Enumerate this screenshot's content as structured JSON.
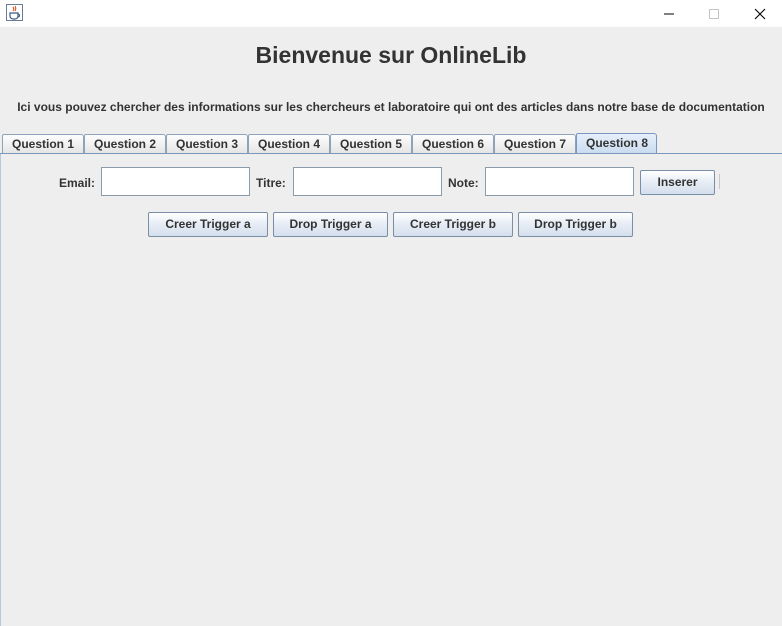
{
  "window": {
    "icons": {
      "app": "java-coffee-cup-icon",
      "minimize": "minimize-icon",
      "maximize": "maximize-icon",
      "close": "close-icon"
    }
  },
  "header": {
    "title": "Bienvenue sur OnlineLib",
    "subtitle": "Ici vous pouvez chercher des informations sur les chercheurs et laboratoire qui ont des articles dans notre base de documentation"
  },
  "tabs": [
    {
      "label": "Question 1"
    },
    {
      "label": "Question 2"
    },
    {
      "label": "Question 3"
    },
    {
      "label": "Question 4"
    },
    {
      "label": "Question 5"
    },
    {
      "label": "Question 6"
    },
    {
      "label": "Question 7"
    },
    {
      "label": "Question 8"
    }
  ],
  "selected_tab": "Question 8",
  "form": {
    "email_label": "Email:",
    "email_value": "",
    "titre_label": "Titre:",
    "titre_value": "",
    "note_label": "Note:",
    "note_value": "",
    "insert_button": "Inserer"
  },
  "triggers": {
    "create_a": "Creer Trigger a",
    "drop_a": "Drop Trigger a",
    "create_b": "Creer Trigger b",
    "drop_b": "Drop Trigger b"
  },
  "colors": {
    "background": "#eeeeee",
    "text": "#333333",
    "tab_selected": "#c9dcf0",
    "border_accent": "#7a98bd"
  }
}
